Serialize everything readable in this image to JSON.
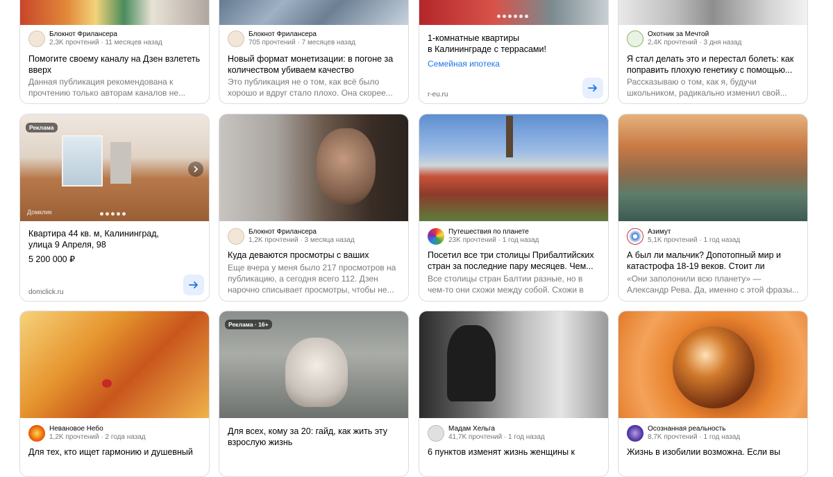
{
  "cards": {
    "r1c1": {
      "channel": "Блокнот Фрилансера",
      "meta": "2,3K прочтений · 11 месяцев назад",
      "title": "Помогите своему каналу на Дзен взлететь вверх",
      "snippet": "Данная публикация рекомендована к прочтению только авторам каналов не..."
    },
    "r1c2": {
      "channel": "Блокнот Фрилансера",
      "meta": "705 прочтений · 7 месяцев назад",
      "title": "Новый формат монетизации: в погоне за количеством убиваем качество",
      "snippet": "Это публикация не о том, как всё было хорошо и вдруг стало плохо. Она скорее..."
    },
    "r1c3": {
      "title_line1": "1-комнатные квартиры",
      "title_line2": "в Калининграде с террасами!",
      "link": "Семейная ипотека",
      "domain": "r-eu.ru"
    },
    "r1c4": {
      "channel": "Охотник за Мечтой",
      "meta": "2,4K прочтений · 3 дня назад",
      "title": "Я стал делать это и перестал болеть: как поправить плохую генетику с помощью...",
      "snippet": "Рассказываю о том, как я, будучи школьником, радикально изменил свой..."
    },
    "r2c1": {
      "badge": "Реклама",
      "watermark": "Домклик",
      "title_line1": "Квартира 44 кв. м, Калининград,",
      "title_line2": "улица 9 Апреля, 98",
      "price": "5 200 000 ₽",
      "domain": "domclick.ru"
    },
    "r2c2": {
      "channel": "Блокнот Фрилансера",
      "meta": "1,2K прочтений · 3 месяца назад",
      "title": "Куда деваются просмотры с ваших каналов",
      "snippet": "Еще вчера у меня было 217 просмотров на публикацию, а сегодня всего 112. Дзен нарочно списывает просмотры, чтобы не..."
    },
    "r2c3": {
      "channel": "Путешествия по планете",
      "meta": "23K прочтений · 1 год назад",
      "title": "Посетил все три столицы Прибалтийских стран за последние пару месяцев. Чем...",
      "snippet": "Все столицы стран Балтии разные, но в чем-то они схожи между собой. Схожи в том, ч..."
    },
    "r2c4": {
      "channel": "Азимут",
      "meta": "5,1K прочтений · 1 год назад",
      "title": "А был ли мальчик? Допотопный мир и катастрофа 18-19 веков. Стоит ли верить...",
      "snippet": "«Они заполонили всю планету» — Александр Рева. Да, именно с этой фразы..."
    },
    "r3c1": {
      "channel": "Невановое Небо",
      "meta": "1,2K прочтений · 2 года назад",
      "title": "Для тех, кто ищет гармонию и душевный"
    },
    "r3c2": {
      "badge": "Реклама · 16+",
      "title": "Для всех, кому за 20: гайд, как жить эту взрослую жизнь"
    },
    "r3c3": {
      "channel": "Мадам Хельга",
      "meta": "41,7K прочтений · 1 год назад",
      "title": "6 пунктов изменят жизнь женщины к"
    },
    "r3c4": {
      "channel": "Осознанная реальность",
      "meta": "8,7K прочтений · 1 год назад",
      "title": "Жизнь в изобилии возможна. Если вы"
    }
  },
  "icons": {
    "arrow": "arrow-right-icon",
    "chevron": "chevron-right-icon"
  },
  "colors": {
    "accent": "#1a73e8",
    "arrow_bg": "#e6effd",
    "border": "#dadce0",
    "muted": "#777777"
  }
}
